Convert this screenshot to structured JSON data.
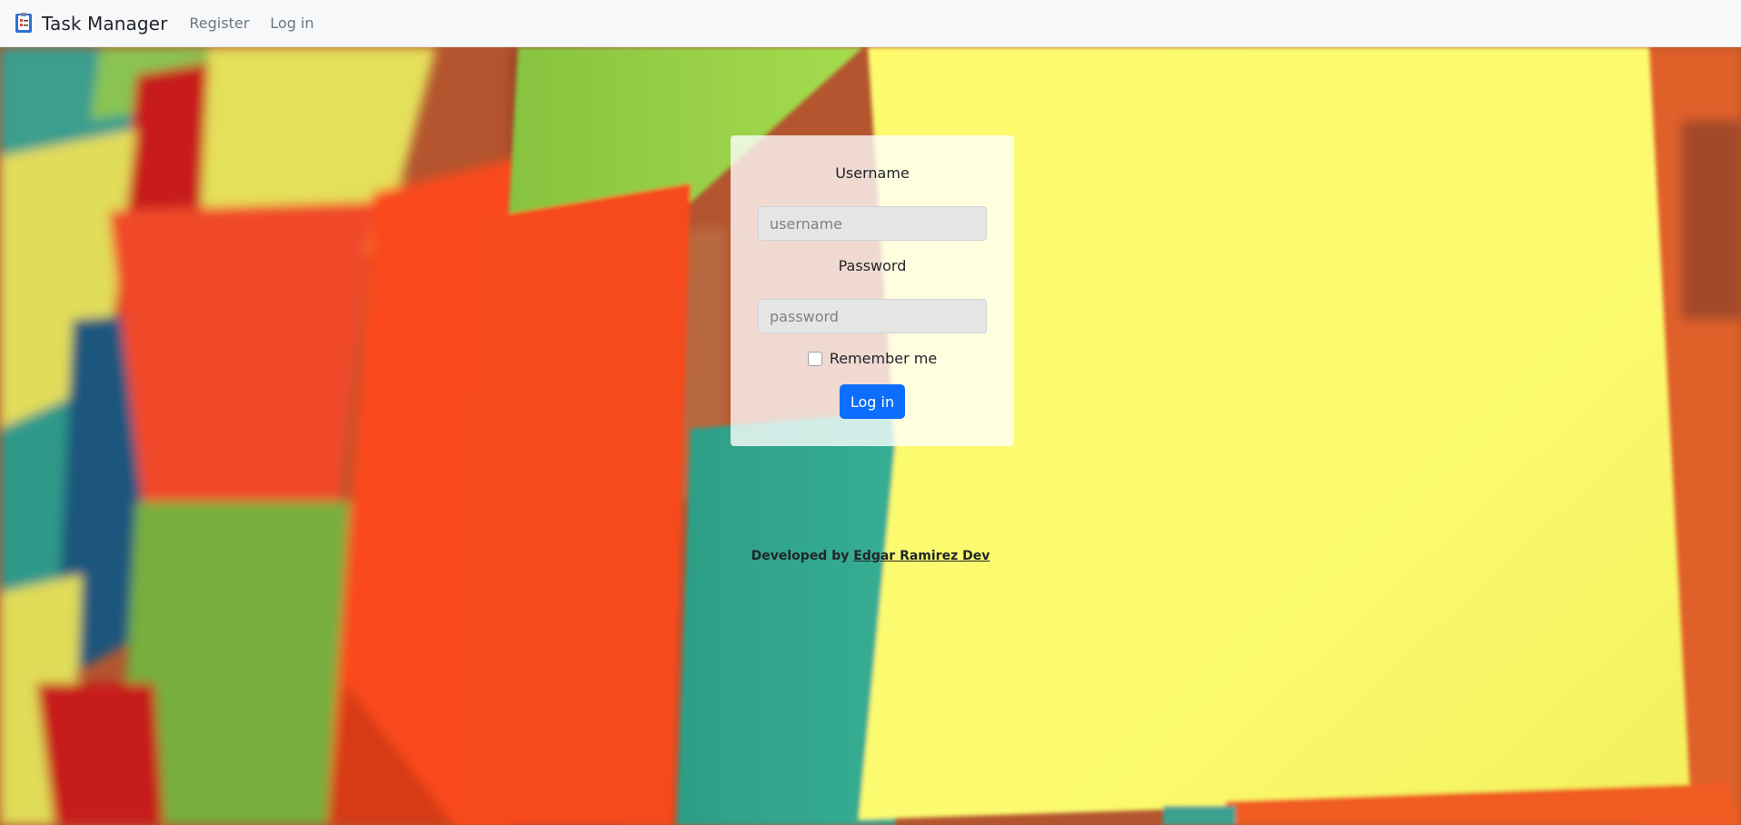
{
  "navbar": {
    "brand": "Task Manager",
    "links": [
      "Register",
      "Log in"
    ]
  },
  "login_form": {
    "username_label": "Username",
    "username_placeholder": "username",
    "password_label": "Password",
    "password_placeholder": "password",
    "remember_label": "Remember me",
    "submit_label": "Log in"
  },
  "footer": {
    "prefix": "Developed by",
    "author": "Edgar Ramirez Dev"
  },
  "icons": {
    "brand": "task-list-icon"
  },
  "colors": {
    "primary": "#0d6efd",
    "navbar_bg": "#f7f8fa",
    "text": "#212529",
    "muted": "#6c757d"
  }
}
